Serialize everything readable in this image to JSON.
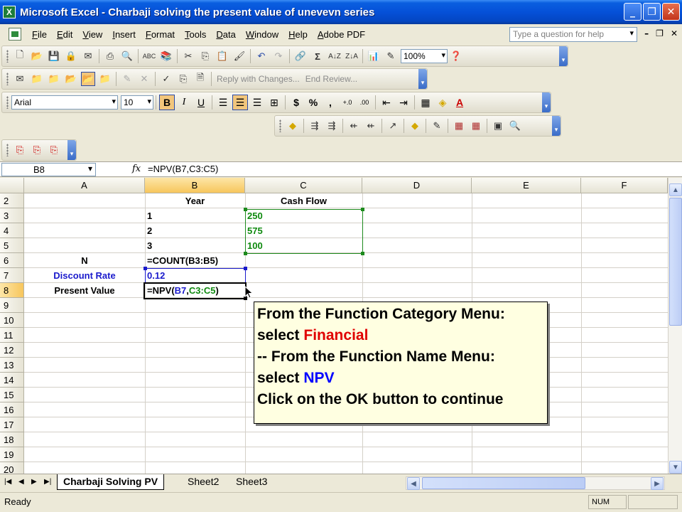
{
  "window": {
    "title": "Microsoft Excel - Charbaji solving the present  value of unevevn series",
    "app_icon_glyph": "X"
  },
  "menu": {
    "items": [
      "File",
      "Edit",
      "View",
      "Insert",
      "Format",
      "Tools",
      "Data",
      "Window",
      "Help",
      "Adobe PDF"
    ],
    "help_placeholder": "Type a question for help"
  },
  "toolbar_standard": {
    "zoom": "100%"
  },
  "toolbar_review": {
    "reply_label": "Reply with Changes...",
    "end_review_label": "End Review..."
  },
  "toolbar_format": {
    "font": "Arial",
    "size": "10",
    "bold_label": "B",
    "italic_label": "I",
    "underline_label": "U",
    "currency_label": "$",
    "percent_label": "%",
    "comma_label": ","
  },
  "formula_bar": {
    "name_box": "B8",
    "fx_label": "fx",
    "formula": "=NPV(B7,C3:C5)"
  },
  "grid": {
    "columns": [
      "A",
      "B",
      "C",
      "D",
      "E",
      "F"
    ],
    "rows": [
      "2",
      "3",
      "4",
      "5",
      "6",
      "7",
      "8",
      "9",
      "10",
      "11",
      "12",
      "13",
      "14",
      "15",
      "16",
      "17",
      "18",
      "19",
      "20"
    ],
    "cells": {
      "B2": "Year",
      "C2": "Cash Flow",
      "B3": "1",
      "C3": "250",
      "B4": "2",
      "C4": "575",
      "B5": "3",
      "C5": "100",
      "A6": "N",
      "B6": "=COUNT(B3:B5)",
      "A7": "Discount Rate",
      "B7": "0.12",
      "A8": "Present Value",
      "B8": {
        "prefix": "=NPV(",
        "ref1": "B7",
        "sep": ",",
        "ref2": "C3:C5",
        "suffix": ")"
      }
    },
    "selected_cell": "B8"
  },
  "callout": {
    "line1": "From the Function Category Menu:",
    "line2_prefix": "select ",
    "line2_highlight": "Financial",
    "line3": "-- From the Function Name Menu:",
    "line4_prefix": "select ",
    "line4_highlight": "NPV",
    "line5": "Click on the OK button to continue",
    "highlight_colors": {
      "category": "#e00000",
      "name": "#0000ff"
    }
  },
  "sheet_tabs": [
    "Charbaji  Solving PV",
    "Sheet2",
    "Sheet3"
  ],
  "active_sheet": "Charbaji  Solving PV",
  "status": {
    "text": "Ready",
    "num": "NUM"
  },
  "colors": {
    "title_blue": "#0550d8",
    "selected_header": "#f7c65c",
    "range_green": "#1d8a1d",
    "range_blue": "#1a1acc",
    "callout_bg": "#ffffe1"
  }
}
